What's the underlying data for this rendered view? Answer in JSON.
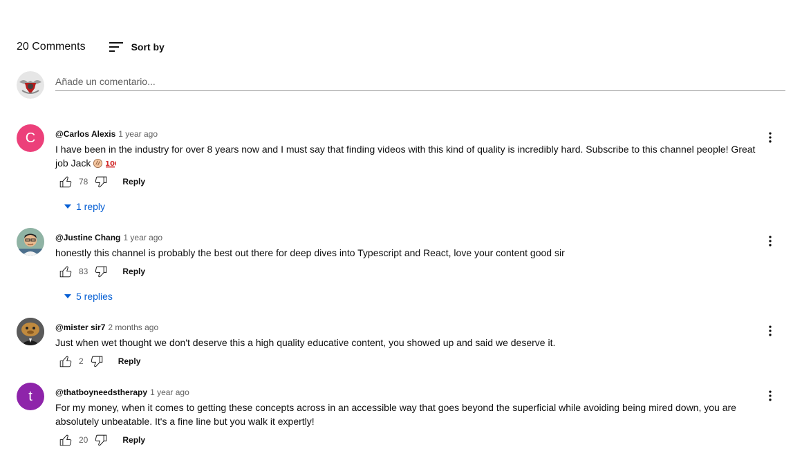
{
  "header": {
    "count_label": "20 Comments",
    "sort_label": "Sort by"
  },
  "add_comment": {
    "placeholder": "Añade un comentario..."
  },
  "comments": [
    {
      "author": "@Carlos Alexis",
      "time": "1 year ago",
      "text": "I have been in the industry for over 8 years now and I must say that finding videos with this kind of quality is incredibly hard. Subscribe to this channel people! Great job Jack",
      "emojis": [
        "clapping-hands-icon",
        "hundred-points-icon"
      ],
      "likes": "78",
      "reply_label": "Reply",
      "replies_label": "1 reply",
      "avatar_letter": "C",
      "avatar_color": "#ec407a"
    },
    {
      "author": "@Justine Chang",
      "time": "1 year ago",
      "text": "honestly this channel is probably the best out there for deep dives into Typescript and React, love your content good sir",
      "likes": "83",
      "reply_label": "Reply",
      "replies_label": "5 replies"
    },
    {
      "author": "@mister sir7",
      "time": "2 months ago",
      "text": "Just when wet thought we don't deserve this a high quality educative content, you showed up and said we deserve it.",
      "likes": "2",
      "reply_label": "Reply"
    },
    {
      "author": "@thatboyneedstherapy",
      "time": "1 year ago",
      "text": "For my money, when it comes to getting these concepts across in an accessible way that goes beyond the superficial while avoiding being mired down, you are absolutely unbeatable. It's a fine line but you walk it expertly!",
      "likes": "20",
      "reply_label": "Reply",
      "avatar_letter": "t",
      "avatar_color": "#8e24aa"
    }
  ],
  "colors": {
    "link_blue": "#065fd4",
    "secondary_text": "#606060",
    "divider": "#909090"
  }
}
